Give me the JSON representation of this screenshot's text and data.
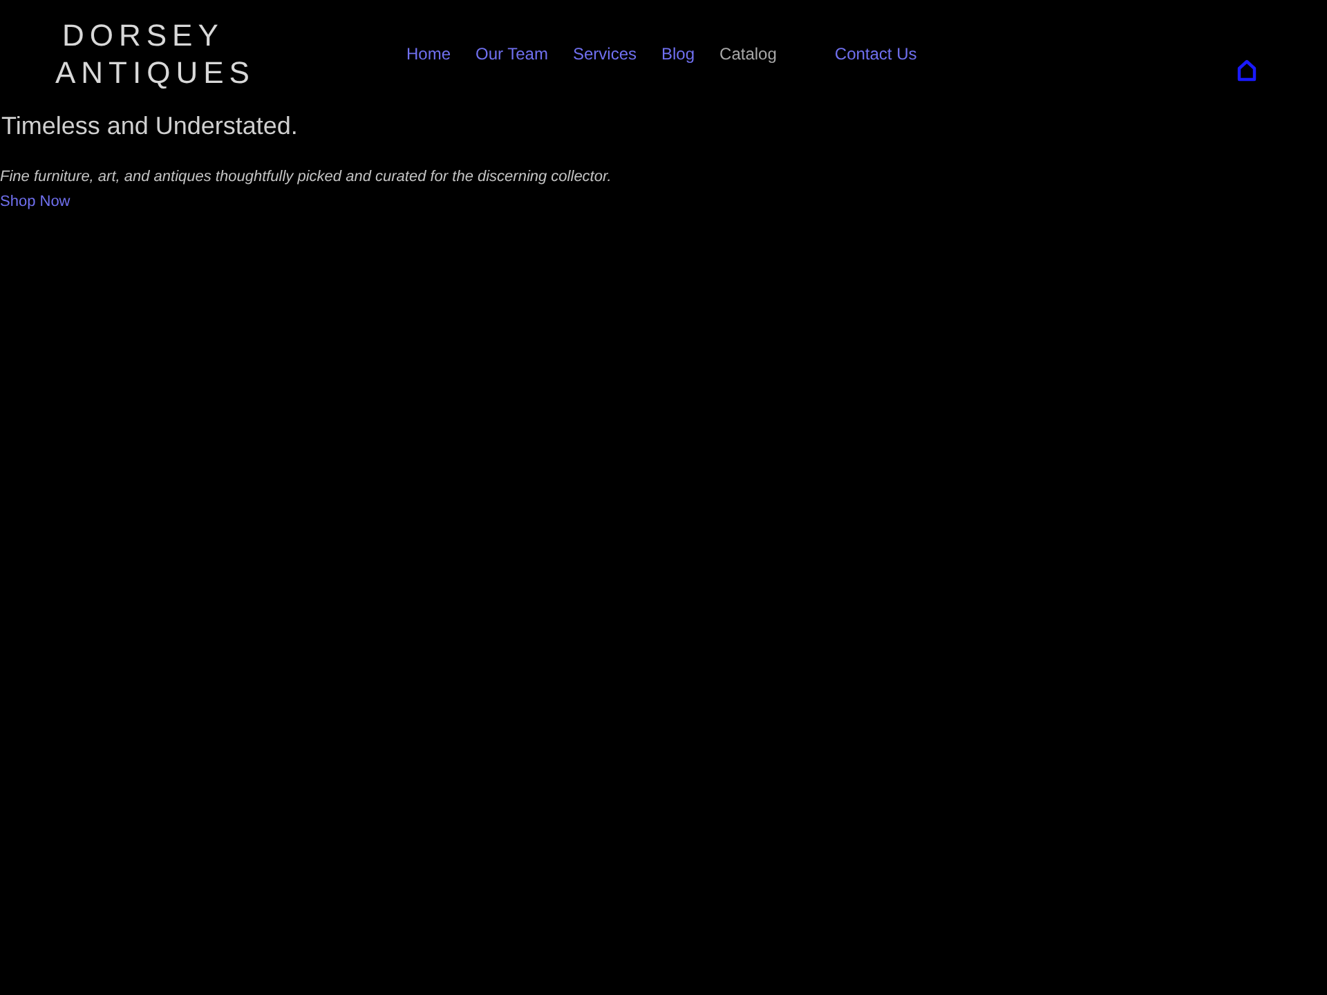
{
  "header": {
    "logo": {
      "line_1": "DORSEY",
      "line_2": "ANTIQUES"
    },
    "nav": [
      {
        "label": "Home",
        "selected": false
      },
      {
        "label": "Our Team",
        "selected": false
      },
      {
        "label": "Services",
        "selected": false
      },
      {
        "label": "Blog",
        "selected": false
      },
      {
        "label": "Catalog",
        "selected": true
      },
      {
        "label": "Contact Us",
        "selected": false
      }
    ]
  },
  "hero": {
    "title": "Timeless and Understated.",
    "subtitle": "Fine furniture, art, and antiques thoughtfully picked and curated for the discerning collector.",
    "link": "Shop Now"
  }
}
